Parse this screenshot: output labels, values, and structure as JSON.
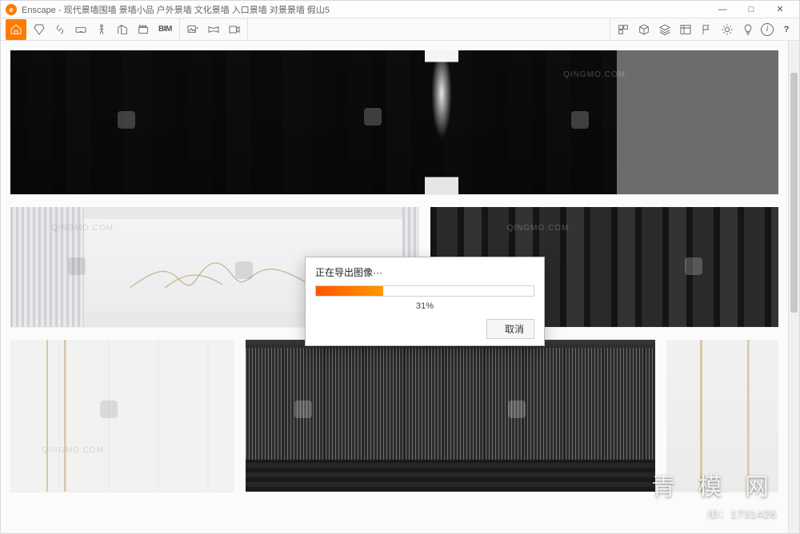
{
  "window": {
    "app_name": "Enscape",
    "title": "Enscape - 现代景墙围墙 景墙小品 户外景墙 文化景墙 入口景墙 对景景墙 假山5",
    "controls": {
      "minimize": "—",
      "maximize": "□",
      "close": "✕"
    }
  },
  "toolbar": {
    "left": {
      "home_icon": "home",
      "tools": [
        "gem-icon",
        "link-icon",
        "goggles-icon",
        "person-icon",
        "building-icon",
        "clapper-icon"
      ],
      "bim_label": "BIM"
    },
    "mid": {
      "tools": [
        "image-export-icon",
        "panorama-icon",
        "video-export-icon"
      ]
    },
    "right": {
      "tools": [
        "manage-views-icon",
        "box-icon",
        "layers-icon",
        "asset-lib-icon",
        "flag-icon",
        "sun-icon",
        "light-icon"
      ],
      "info_icon": "i",
      "help_icon": "?"
    }
  },
  "dialog": {
    "title": "正在导出图像···",
    "percent_value": 31,
    "percent_label": "31%",
    "cancel_label": "取消"
  },
  "watermark": {
    "site_text": "QINGMO.COM",
    "brand_big": "青 模 网",
    "brand_id": "ID：1731426"
  },
  "colors": {
    "accent": "#ff7b00",
    "progress_start": "#ff5400",
    "progress_end": "#ff9a00"
  }
}
